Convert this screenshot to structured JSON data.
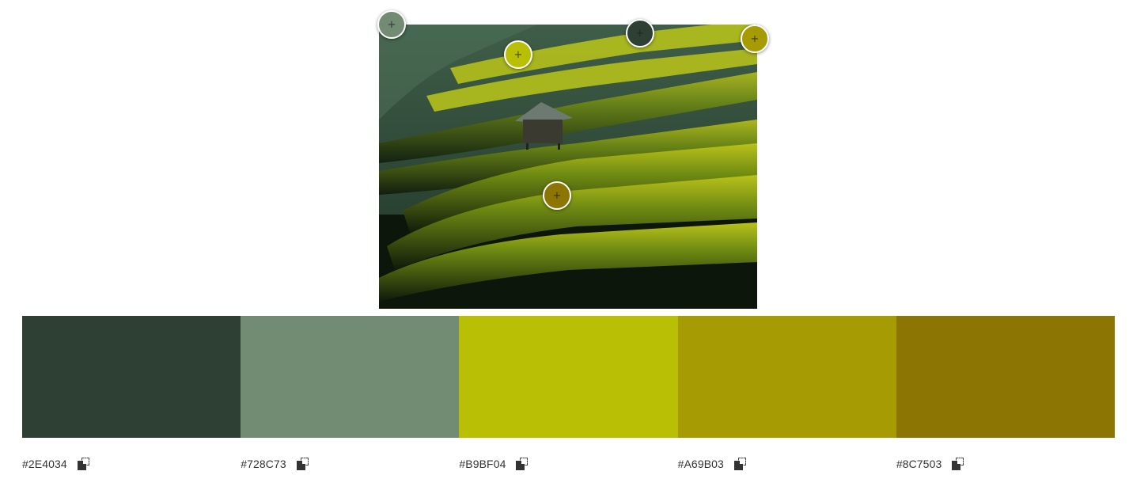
{
  "image": {
    "alt_icon": "rice-terrace-photo"
  },
  "pickers": [
    {
      "name": "picker-1",
      "color": "#728C73",
      "icon": "plus-icon"
    },
    {
      "name": "picker-2",
      "color": "#B9BF04",
      "icon": "plus-icon"
    },
    {
      "name": "picker-3",
      "color": "#2E4034",
      "icon": "plus-icon"
    },
    {
      "name": "picker-4",
      "color": "#A69B03",
      "icon": "plus-icon"
    },
    {
      "name": "picker-5",
      "color": "#8C7503",
      "icon": "plus-icon"
    }
  ],
  "palette": [
    {
      "hex": "#2E4034",
      "copy_icon": "copy-icon"
    },
    {
      "hex": "#728C73",
      "copy_icon": "copy-icon"
    },
    {
      "hex": "#B9BF04",
      "copy_icon": "copy-icon"
    },
    {
      "hex": "#A69B03",
      "copy_icon": "copy-icon"
    },
    {
      "hex": "#8C7503",
      "copy_icon": "copy-icon"
    }
  ]
}
